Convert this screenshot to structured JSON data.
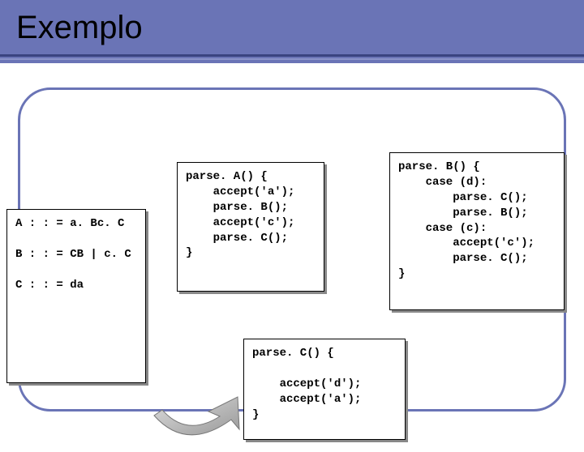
{
  "title": "Exemplo",
  "grammar": "A : : = a. Bc. C\n\nB : : = CB | c. C\n\nC : : = da",
  "parseA": "parse. A() {\n    accept('a');\n    parse. B();\n    accept('c');\n    parse. C();\n}",
  "parseB": "parse. B() {\n    case (d):\n        parse. C();\n        parse. B();\n    case (c):\n        accept('c');\n        parse. C();\n}",
  "parseC": "parse. C() {\n\n    accept('d');\n    accept('a');\n}"
}
